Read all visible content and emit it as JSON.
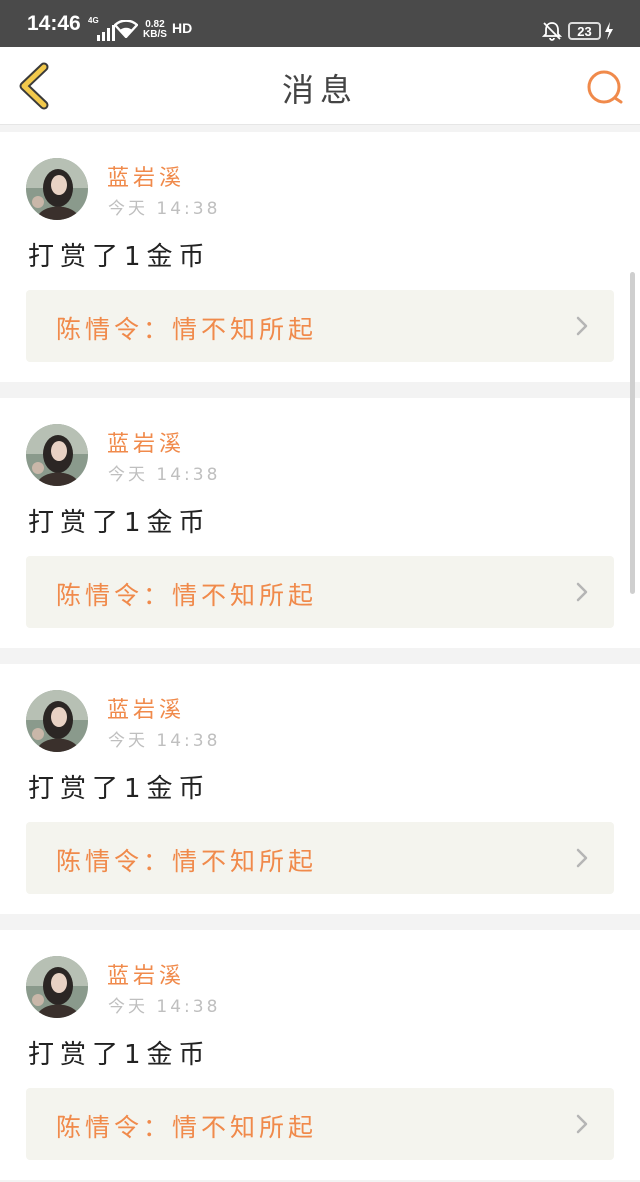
{
  "status_bar": {
    "time": "14:46",
    "network_type": "4G",
    "net_speed_value": "0.82",
    "net_speed_unit": "KB/S",
    "hd_label": "HD",
    "battery_level": "23"
  },
  "header": {
    "title": "消息"
  },
  "messages": [
    {
      "sender": "蓝岩溪",
      "time": "今天 14:38",
      "content": "打赏了1金币",
      "link_text": "陈情令：情不知所起"
    },
    {
      "sender": "蓝岩溪",
      "time": "今天 14:38",
      "content": "打赏了1金币",
      "link_text": "陈情令：情不知所起"
    },
    {
      "sender": "蓝岩溪",
      "time": "今天 14:38",
      "content": "打赏了1金币",
      "link_text": "陈情令：情不知所起"
    },
    {
      "sender": "蓝岩溪",
      "time": "今天 14:38",
      "content": "打赏了1金币",
      "link_text": "陈情令：情不知所起"
    }
  ],
  "colors": {
    "accent": "#f08a4b",
    "back_arrow": "#f2c94c",
    "status_bar_bg": "#4a4a4a",
    "link_bg": "#f4f4ee"
  },
  "icons": {
    "back": "back-arrow-icon",
    "search": "search-icon",
    "chevron": "chevron-right-icon"
  }
}
